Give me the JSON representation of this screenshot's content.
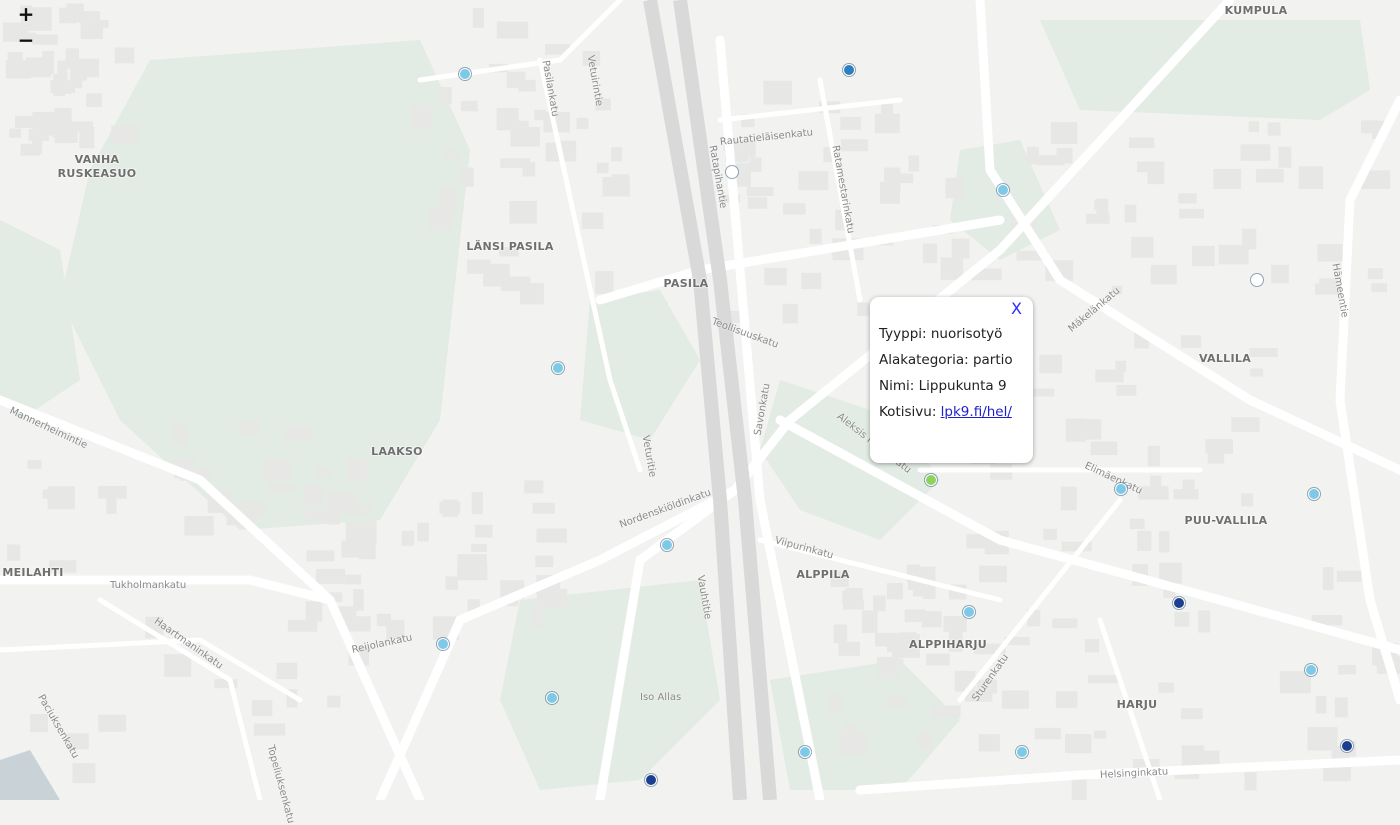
{
  "zoom": {
    "in_label": "+",
    "out_label": "−"
  },
  "districts": [
    "KUMPULA",
    "VANHA\nRUSKEASUO",
    "LÄNSI PASILA",
    "PASILA",
    "VALLILA",
    "LAAKSO",
    "MEILAHTI",
    "PUU-VALLILA",
    "ALPPILA",
    "ALPPIHARJU",
    "HARJU"
  ],
  "streets": [
    "Vetuirintie",
    "Pasilankatu",
    "Rautatieläisenkatu",
    "Ratapihantie",
    "Ratamestarinkatu",
    "Teollisuuskatu",
    "Veturitie",
    "Savonkatu",
    "Aleksis Kiven katu",
    "Mäkelänkatu",
    "Nordenskiöldinkatu",
    "Mannerheimintie",
    "Tukholmankatu",
    "Reijolankatu",
    "Vauhtitie",
    "Viipurinkatu",
    "Sturenkatu",
    "Helsinginkatu",
    "Topeliuksenkatu",
    "Paciuksenkatu",
    "Haartmaninkatu",
    "Hämeentie",
    "Elimäenkatu",
    "Iso Allas"
  ],
  "markers": [
    {
      "name": "marker",
      "color": "#7ec8e8"
    },
    {
      "name": "marker",
      "color": "#2e7fbf"
    },
    {
      "name": "marker",
      "color": "#ffffff"
    },
    {
      "name": "marker",
      "color": "#7ec8e8"
    },
    {
      "name": "marker",
      "color": "#ffffff"
    },
    {
      "name": "marker",
      "color": "#7ec8e8"
    },
    {
      "name": "marker-selected",
      "color": "#8fd15f"
    },
    {
      "name": "marker",
      "color": "#7ec8e8"
    },
    {
      "name": "marker",
      "color": "#7ec8e8"
    },
    {
      "name": "marker",
      "color": "#7ec8e8"
    },
    {
      "name": "marker",
      "color": "#7ec8e8"
    },
    {
      "name": "marker",
      "color": "#1d3f8f"
    },
    {
      "name": "marker",
      "color": "#7ec8e8"
    },
    {
      "name": "marker",
      "color": "#7ec8e8"
    },
    {
      "name": "marker",
      "color": "#7ec8e8"
    },
    {
      "name": "marker",
      "color": "#7ec8e8"
    },
    {
      "name": "marker",
      "color": "#7ec8e8"
    },
    {
      "name": "marker",
      "color": "#1d3f8f"
    },
    {
      "name": "marker",
      "color": "#1d3f8f"
    }
  ],
  "popup": {
    "close_label": "X",
    "type_label": "Tyyppi:",
    "type_value": "nuorisotyö",
    "subcategory_label": "Alakategoria:",
    "subcategory_value": "partio",
    "name_label": "Nimi:",
    "name_value": "Lippukunta 9",
    "homepage_label": "Kotisivu:",
    "homepage_value": "lpk9.fi/hel/"
  },
  "colors": {
    "land": "#f2f2f1",
    "park": "#e3ebe5",
    "block": "#e7e7e6",
    "road": "#ffffff",
    "rail": "#d9d9d9",
    "water": "#c9d2d6"
  }
}
